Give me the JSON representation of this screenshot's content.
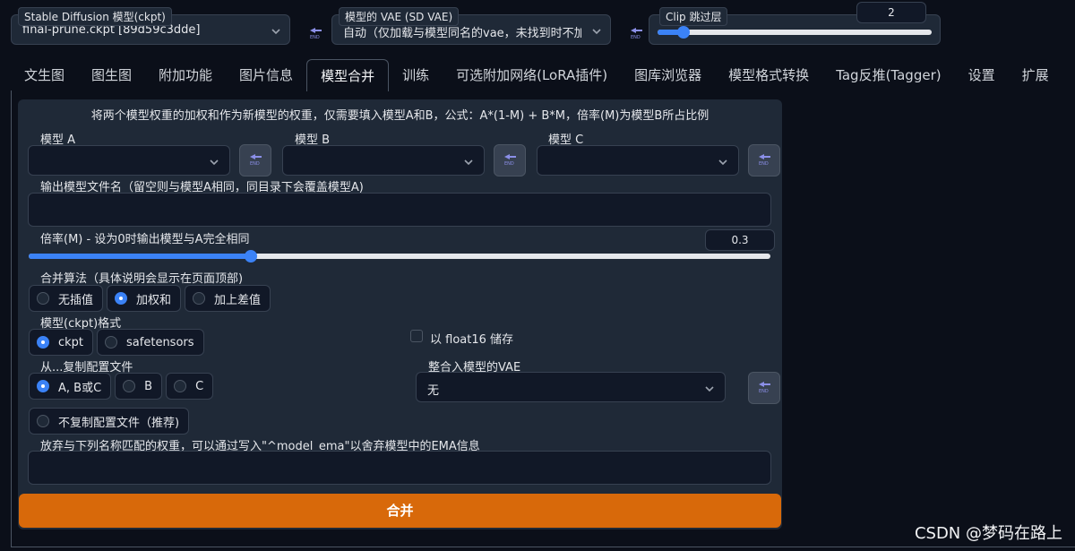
{
  "top": {
    "ckpt_label": "Stable Diffusion 模型(ckpt)",
    "ckpt_value": "final-prune.ckpt [89d59c3dde]",
    "vae_label": "模型的 VAE (SD VAE)",
    "vae_value": "自动（仅加载与模型同名的vae，未找到时不加",
    "clip_label": "Clip 跳过层",
    "clip_value": "2",
    "clip_fraction": 0.0
  },
  "tabs": [
    "文生图",
    "图生图",
    "附加功能",
    "图片信息",
    "模型合并",
    "训练",
    "可选附加网络(LoRA插件)",
    "图库浏览器",
    "模型格式转换",
    "Tag反推(Tagger)",
    "设置",
    "扩展"
  ],
  "active_tab": 4,
  "merge": {
    "description": "将两个模型权重的加权和作为新模型的权重，仅需要填入模型A和B，公式：A*(1-M) + B*M，倍率(M)为模型B所占比例",
    "model_a_label": "模型 A",
    "model_b_label": "模型 B",
    "model_c_label": "模型 C",
    "output_name_label": "输出模型文件名（留空则与模型A相同，同目录下会覆盖模型A)",
    "multiplier_label": "倍率(M) - 设为0时输出模型与A完全相同",
    "multiplier_value": "0.3",
    "multiplier_fraction": 0.3,
    "method_label": "合并算法（具体说明会显示在页面顶部)",
    "methods": [
      "无插值",
      "加权和",
      "加上差值"
    ],
    "method_selected": 1,
    "format_label": "模型(ckpt)格式",
    "formats": [
      "ckpt",
      "safetensors"
    ],
    "format_selected": 0,
    "float16_label": "以 float16 储存",
    "copy_config_label": "从...复制配置文件",
    "copy_config_options": [
      "A, B或C",
      "B",
      "C"
    ],
    "copy_config_selected": 0,
    "no_copy_label": "不复制配置文件（推荐)",
    "bake_vae_label": "整合入模型的VAE",
    "bake_vae_value": "无",
    "discard_label": "放弃与下列名称匹配的权重，可以通过写入\"^model_ema\"以舍弃模型中的EMA信息",
    "merge_button": "合并"
  },
  "watermark": "CSDN @梦码在路上",
  "colors": {
    "accent": "#3b82f6",
    "merge_button": "#d8690a",
    "background": "#0b0f19",
    "panel": "#1f2937"
  }
}
